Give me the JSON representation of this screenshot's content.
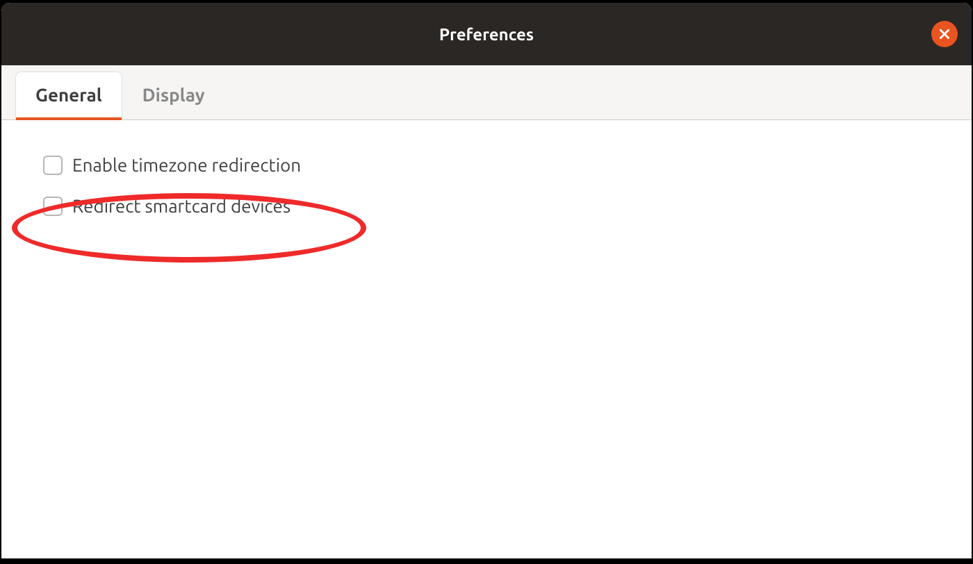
{
  "titlebar": {
    "title": "Preferences"
  },
  "tabs": [
    {
      "label": "General",
      "active": true
    },
    {
      "label": "Display",
      "active": false
    }
  ],
  "options": [
    {
      "label": "Enable timezone redirection",
      "checked": false
    },
    {
      "label": "Redirect smartcard devices",
      "checked": false
    }
  ]
}
